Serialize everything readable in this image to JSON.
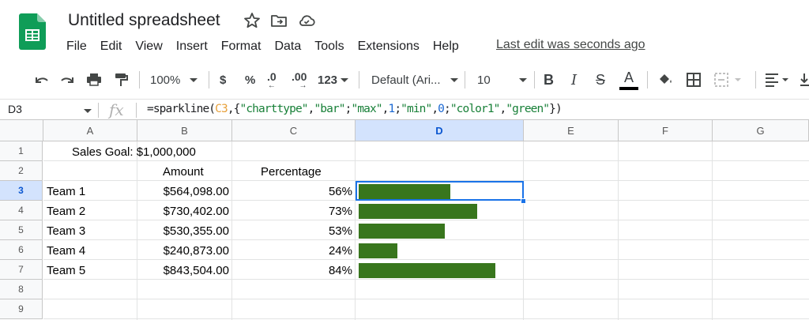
{
  "app": {
    "title": "Untitled spreadsheet",
    "last_edit": "Last edit was seconds ago",
    "menu": [
      "File",
      "Edit",
      "View",
      "Insert",
      "Format",
      "Data",
      "Tools",
      "Extensions",
      "Help"
    ]
  },
  "toolbar": {
    "zoom": "100%",
    "currency": "$",
    "percent": "%",
    "decrease_decimals": ".0",
    "increase_decimals": ".00",
    "more_formats": "123",
    "font": "Default (Ari...",
    "font_size": "10",
    "bold": "B",
    "italic": "I",
    "strikethrough": "S",
    "text_color": "A"
  },
  "formula_bar": {
    "name_box": "D3",
    "fx": "fx",
    "formula_parts": {
      "fn": "=sparkline(",
      "ref": "C3",
      "p1": ",{",
      "s1": "\"charttype\"",
      "p2": ",",
      "s2": "\"bar\"",
      "p3": ";",
      "s3": "\"max\"",
      "p4": ",",
      "n1": "1",
      "p5": ";",
      "s4": "\"min\"",
      "p6": ",",
      "n2": "0",
      "p7": ";",
      "s5": "\"color1\"",
      "p8": ",",
      "s6": "\"green\"",
      "p9": "})"
    }
  },
  "grid": {
    "columns": [
      "A",
      "B",
      "C",
      "D",
      "E",
      "F",
      "G"
    ],
    "rows": [
      "1",
      "2",
      "3",
      "4",
      "5",
      "6",
      "7",
      "8",
      "9"
    ],
    "selected_cell": "D3",
    "goal_label": "Sales Goal: $1,000,000",
    "headers": {
      "amount": "Amount",
      "percentage": "Percentage"
    },
    "teams": [
      {
        "name": "Team 1",
        "amount": "$564,098.00",
        "percentage": "56%",
        "fraction": 0.564
      },
      {
        "name": "Team 2",
        "amount": "$730,402.00",
        "percentage": "73%",
        "fraction": 0.73
      },
      {
        "name": "Team 3",
        "amount": "$530,355.00",
        "percentage": "53%",
        "fraction": 0.53
      },
      {
        "name": "Team 4",
        "amount": "$240,873.00",
        "percentage": "24%",
        "fraction": 0.241
      },
      {
        "name": "Team 5",
        "amount": "$843,504.00",
        "percentage": "84%",
        "fraction": 0.844
      }
    ],
    "sparkline_color": "#38761d"
  }
}
